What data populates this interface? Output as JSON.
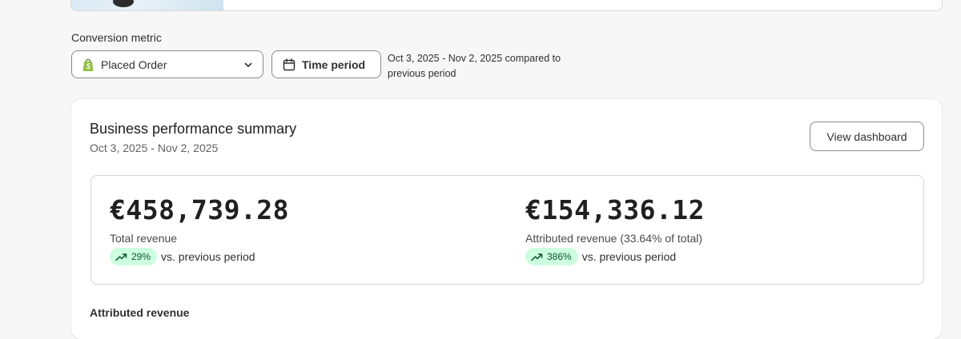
{
  "conversion_metric": {
    "label": "Conversion metric",
    "selected_value": "Placed Order",
    "time_period_button": "Time period",
    "period_description": "Oct 3, 2025 - Nov 2, 2025 compared to previous period"
  },
  "summary": {
    "title": "Business performance summary",
    "date_range": "Oct 3, 2025 - Nov 2, 2025",
    "view_dashboard_label": "View dashboard",
    "metrics": [
      {
        "value": "€458,739.28",
        "caption": "Total revenue",
        "change": "29%",
        "comparison": "vs. previous period"
      },
      {
        "value": "€154,336.12",
        "caption": "Attributed revenue (33.64% of total)",
        "change": "386%",
        "comparison": "vs. previous period"
      }
    ],
    "section_heading": "Attributed revenue"
  },
  "icons": {
    "select_icon": "shopify-bag-icon",
    "dropdown_icon": "chevron-down-icon",
    "time_icon": "calendar-icon",
    "trend_icon": "trend-up-icon"
  },
  "colors": {
    "badge_bg": "#cdfee1",
    "badge_text": "#0c5132",
    "shopify_green": "#95bf47"
  }
}
